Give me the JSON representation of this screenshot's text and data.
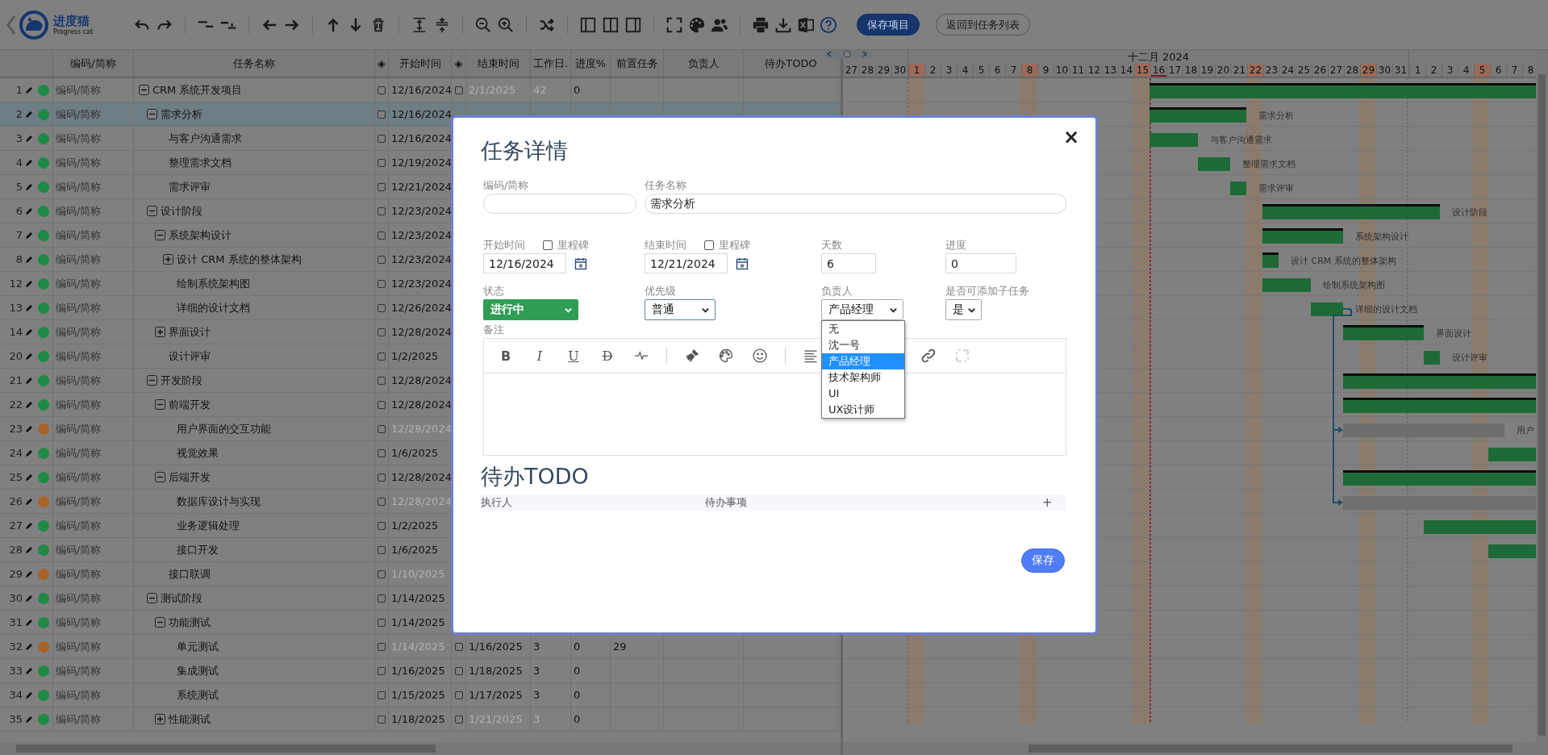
{
  "toolbar": {
    "logo": {
      "name": "进度猫",
      "subtitle": "Progress cat"
    },
    "buttons": [
      {
        "label": "保存项目",
        "kind": "primary"
      },
      {
        "label": "返回到任务列表",
        "kind": "secondary"
      }
    ]
  },
  "columns": [
    "编码/简称",
    "任务名称",
    "◈",
    "开始时间",
    "◈",
    "结束时间",
    "工作日.",
    "进度%",
    "前置任务",
    "负责人",
    "待办TODO"
  ],
  "tasks": [
    {
      "id": "1",
      "color": "#1f8a45",
      "code": "编码/简称",
      "name": "CRM 系统开发项目",
      "selected": false,
      "expanded": true,
      "start_milestone": false,
      "start": "12/16/2024",
      "start_muted": false,
      "end_milestone": false,
      "end": "2/1/2025",
      "end_muted": true,
      "workdays": "42",
      "progress": "0",
      "bar": {
        "kind": "summary"
      },
      "children": [
        {
          "id": "2",
          "color": "#1f8a45",
          "code": "编码/简称",
          "name": "需求分析",
          "selected": true,
          "expanded": true,
          "start_milestone": false,
          "start": "12/16/2024",
          "start_muted": false,
          "bar": {
            "kind": "summary",
            "label": "需求分析"
          },
          "children": [
            {
              "id": "3",
              "color": "#1f8a45",
              "code": "编码/简称",
              "name": "与客户沟通需求",
              "selected": false,
              "start_milestone": false,
              "start": "12/16/2024",
              "start_muted": false,
              "bar": {
                "kind": "task",
                "label": "与客户沟通需求"
              }
            },
            {
              "id": "4",
              "color": "#1f8a45",
              "code": "编码/简称",
              "name": "整理需求文档",
              "selected": false,
              "start_milestone": false,
              "start": "12/19/2024",
              "start_muted": false,
              "bar": {
                "kind": "task",
                "label": "整理需求文档"
              }
            },
            {
              "id": "5",
              "color": "#1f8a45",
              "code": "编码/简称",
              "name": "需求评审",
              "selected": false,
              "start_milestone": false,
              "start": "12/21/2024",
              "start_muted": false,
              "bar": {
                "kind": "task",
                "label": "需求评审"
              }
            }
          ]
        },
        {
          "id": "6",
          "color": "#1f8a45",
          "code": "编码/简称",
          "name": "设计阶段",
          "selected": false,
          "expanded": true,
          "start_milestone": false,
          "start": "12/23/2024",
          "start_muted": false,
          "bar": {
            "kind": "summary",
            "label": "设计阶段"
          },
          "children": [
            {
              "id": "7",
              "color": "#1f8a45",
              "code": "编码/简称",
              "name": "系统架构设计",
              "selected": false,
              "expanded": true,
              "start_milestone": false,
              "start": "12/23/2024",
              "start_muted": false,
              "bar": {
                "kind": "summary",
                "label": "系统架构设计"
              },
              "children": [
                {
                  "id": "8",
                  "color": "#1f8a45",
                  "code": "编码/简称",
                  "name": "设计 CRM 系统的整体架构",
                  "selected": false,
                  "expanded": false,
                  "start_milestone": false,
                  "start": "12/23/2024",
                  "start_muted": false,
                  "bar": {
                    "kind": "summary",
                    "label": "设计 CRM 系统的整体架构"
                  }
                },
                {
                  "id": "12",
                  "color": "#1f8a45",
                  "code": "编码/简称",
                  "name": "绘制系统架构图",
                  "selected": false,
                  "start_milestone": false,
                  "start": "12/23/2024",
                  "start_muted": false,
                  "bar": {
                    "kind": "task",
                    "label": "绘制系统架构图"
                  }
                },
                {
                  "id": "13",
                  "color": "#1f8a45",
                  "code": "编码/简称",
                  "name": "详细的设计文档",
                  "selected": false,
                  "start_milestone": false,
                  "start": "12/26/2024",
                  "start_muted": false,
                  "bar": {
                    "kind": "task",
                    "label": "详细的设计文档",
                    "link_source": true
                  }
                }
              ]
            },
            {
              "id": "14",
              "color": "#1f8a45",
              "code": "编码/简称",
              "name": "界面设计",
              "selected": false,
              "expanded": false,
              "start_milestone": false,
              "start": "12/28/2024",
              "start_muted": false,
              "bar": {
                "kind": "summary",
                "label": "界面设计"
              }
            },
            {
              "id": "20",
              "color": "#1f8a45",
              "code": "编码/简称",
              "name": "设计评审",
              "selected": false,
              "start_milestone": false,
              "start": "1/2/2025",
              "start_muted": false,
              "bar": {
                "kind": "task",
                "label": "设计评审"
              }
            }
          ]
        },
        {
          "id": "21",
          "color": "#1f8a45",
          "code": "编码/简称",
          "name": "开发阶段",
          "selected": false,
          "expanded": true,
          "start_milestone": false,
          "start": "12/28/2024",
          "start_muted": false,
          "bar": {
            "kind": "summary"
          },
          "children": [
            {
              "id": "22",
              "color": "#1f8a45",
              "code": "编码/简称",
              "name": "前端开发",
              "selected": false,
              "expanded": true,
              "start_milestone": false,
              "start": "12/28/2024",
              "start_muted": false,
              "bar": {
                "kind": "summary"
              },
              "children": [
                {
                  "id": "23",
                  "color": "#a8632a",
                  "code": "编码/简称",
                  "name": "用户界面的交互功能",
                  "selected": false,
                  "start_milestone": false,
                  "start": "12/28/2024",
                  "start_muted": true,
                  "bar": {
                    "kind": "pending",
                    "label": "用户",
                    "linked": true
                  }
                },
                {
                  "id": "24",
                  "color": "#1f8a45",
                  "code": "编码/简称",
                  "name": "视觉效果",
                  "selected": false,
                  "start_milestone": false,
                  "start": "1/6/2025",
                  "start_muted": false,
                  "bar": {
                    "kind": "task"
                  }
                }
              ]
            },
            {
              "id": "25",
              "color": "#1f8a45",
              "code": "编码/简称",
              "name": "后端开发",
              "selected": false,
              "expanded": true,
              "start_milestone": false,
              "start": "12/28/2024",
              "start_muted": false,
              "bar": {
                "kind": "summary"
              },
              "children": [
                {
                  "id": "26",
                  "color": "#a8632a",
                  "code": "编码/简称",
                  "name": "数据库设计与实现",
                  "selected": false,
                  "start_milestone": false,
                  "start": "12/28/2024",
                  "start_muted": true,
                  "bar": {
                    "kind": "pending",
                    "linked": true
                  }
                },
                {
                  "id": "27",
                  "color": "#1f8a45",
                  "code": "编码/简称",
                  "name": "业务逻辑处理",
                  "selected": false,
                  "start_milestone": false,
                  "start": "1/2/2025",
                  "start_muted": false,
                  "bar": {
                    "kind": "task"
                  }
                },
                {
                  "id": "28",
                  "color": "#1f8a45",
                  "code": "编码/简称",
                  "name": "接口开发",
                  "selected": false,
                  "start_milestone": false,
                  "start": "1/6/2025",
                  "start_muted": false,
                  "bar": {
                    "kind": "task"
                  }
                }
              ]
            },
            {
              "id": "29",
              "color": "#a8632a",
              "code": "编码/简称",
              "name": "接口联调",
              "selected": false,
              "start_milestone": false,
              "start": "1/10/2025",
              "start_muted": true
            }
          ]
        },
        {
          "id": "30",
          "color": "#1f8a45",
          "code": "编码/简称",
          "name": "测试阶段",
          "selected": false,
          "expanded": true,
          "start_milestone": false,
          "start": "1/14/2025",
          "start_muted": false,
          "children": [
            {
              "id": "31",
              "color": "#1f8a45",
              "code": "编码/简称",
              "name": "功能测试",
              "selected": false,
              "expanded": true,
              "start_milestone": false,
              "start": "1/14/2025",
              "start_muted": false,
              "children": [
                {
                  "id": "32",
                  "color": "#a8632a",
                  "code": "编码/简称",
                  "name": "单元测试",
                  "selected": false,
                  "start_milestone": false,
                  "start": "1/14/2025",
                  "start_muted": true,
                  "end_milestone": false,
                  "end": "1/16/2025",
                  "end_muted": false,
                  "workdays": "3",
                  "progress": "0",
                  "predecessor": "29"
                },
                {
                  "id": "33",
                  "color": "#1f8a45",
                  "code": "编码/简称",
                  "name": "集成测试",
                  "selected": false,
                  "start_milestone": false,
                  "start": "1/16/2025",
                  "start_muted": false,
                  "end_milestone": false,
                  "end": "1/18/2025",
                  "end_muted": false,
                  "workdays": "3",
                  "progress": "0"
                },
                {
                  "id": "34",
                  "color": "#1f8a45",
                  "code": "编码/简称",
                  "name": "系统测试",
                  "selected": false,
                  "start_milestone": false,
                  "start": "1/15/2025",
                  "start_muted": false,
                  "end_milestone": false,
                  "end": "1/17/2025",
                  "end_muted": false,
                  "workdays": "3",
                  "progress": "0"
                }
              ]
            },
            {
              "id": "35",
              "color": "#1f8a45",
              "code": "编码/简称",
              "name": "性能测试",
              "selected": false,
              "expanded": false,
              "start_milestone": false,
              "start": "1/18/2025",
              "start_muted": false,
              "end_milestone": false,
              "end": "1/21/2025",
              "end_muted": true,
              "workdays": "3",
              "progress": "0"
            }
          ]
        }
      ]
    }
  ],
  "gantt": {
    "months": [
      {
        "days": [
          {
            "label": "27",
            "weekend": false,
            "today": false
          },
          {
            "label": "28",
            "weekend": false,
            "today": false
          },
          {
            "label": "29",
            "weekend": false,
            "today": false
          },
          {
            "label": "30",
            "weekend": false,
            "today": false
          }
        ]
      },
      {
        "label": "十二月 2024",
        "days": [
          {
            "label": "1",
            "weekend": true,
            "today": false
          },
          {
            "label": "2",
            "weekend": false,
            "today": false
          },
          {
            "label": "3",
            "weekend": false,
            "today": false
          },
          {
            "label": "4",
            "weekend": false,
            "today": false
          },
          {
            "label": "5",
            "weekend": false,
            "today": false
          },
          {
            "label": "6",
            "weekend": false,
            "today": false
          },
          {
            "label": "7",
            "weekend": false,
            "today": false
          },
          {
            "label": "8",
            "weekend": true,
            "today": false
          },
          {
            "label": "9",
            "weekend": false,
            "today": false
          },
          {
            "label": "10",
            "weekend": false,
            "today": false
          },
          {
            "label": "11",
            "weekend": false,
            "today": false
          },
          {
            "label": "12",
            "weekend": false,
            "today": false
          },
          {
            "label": "13",
            "weekend": false,
            "today": false
          },
          {
            "label": "14",
            "weekend": false,
            "today": false
          },
          {
            "label": "15",
            "weekend": true,
            "today": false
          },
          {
            "label": "16",
            "weekend": false,
            "today": true
          },
          {
            "label": "17",
            "weekend": false,
            "today": false
          },
          {
            "label": "18",
            "weekend": false,
            "today": false
          },
          {
            "label": "19",
            "weekend": false,
            "today": false
          },
          {
            "label": "20",
            "weekend": false,
            "today": false
          },
          {
            "label": "21",
            "weekend": false,
            "today": false
          },
          {
            "label": "22",
            "weekend": true,
            "today": false
          },
          {
            "label": "23",
            "weekend": false,
            "today": false
          },
          {
            "label": "24",
            "weekend": false,
            "today": false
          },
          {
            "label": "25",
            "weekend": false,
            "today": false
          },
          {
            "label": "26",
            "weekend": false,
            "today": false
          },
          {
            "label": "27",
            "weekend": false,
            "today": false
          },
          {
            "label": "28",
            "weekend": false,
            "today": false
          },
          {
            "label": "29",
            "weekend": true,
            "today": false
          },
          {
            "label": "30",
            "weekend": false,
            "today": false
          },
          {
            "label": "31",
            "weekend": false,
            "today": false
          }
        ]
      },
      {
        "days": [
          {
            "label": "1",
            "weekend": false,
            "today": false
          },
          {
            "label": "2",
            "weekend": false,
            "today": false
          },
          {
            "label": "3",
            "weekend": false,
            "today": false
          },
          {
            "label": "4",
            "weekend": false,
            "today": false
          },
          {
            "label": "5",
            "weekend": true,
            "today": false
          },
          {
            "label": "6",
            "weekend": false,
            "today": false
          },
          {
            "label": "7",
            "weekend": false,
            "today": false
          },
          {
            "label": "8",
            "weekend": false,
            "today": false
          }
        ]
      }
    ]
  },
  "dialog": {
    "title": "任务详情",
    "close": "×",
    "code": {
      "label": "编码/简称"
    },
    "name": {
      "label": "任务名称",
      "value": "需求分析"
    },
    "start": {
      "label": "开始时间",
      "milestone_label": "里程碑",
      "milestone": false,
      "value": "12/16/2024"
    },
    "end": {
      "label": "结束时间",
      "milestone_label": "里程碑",
      "milestone": false,
      "value": "12/21/2024"
    },
    "days": {
      "label": "天数",
      "value": "6"
    },
    "progress": {
      "label": "进度",
      "value": "0"
    },
    "status": {
      "label": "状态",
      "value": "进行中"
    },
    "priority": {
      "label": "优先级",
      "value": "普通"
    },
    "owner": {
      "label": "负责人",
      "value": "产品经理",
      "expanded": true,
      "options": [
        {
          "label": "无",
          "selected": false
        },
        {
          "label": "沈一号",
          "selected": false
        },
        {
          "label": "产品经理",
          "selected": true
        },
        {
          "label": "技术架构师",
          "selected": false
        },
        {
          "label": "UI",
          "selected": false
        },
        {
          "label": "UX设计师",
          "selected": false
        }
      ]
    },
    "subtasks": {
      "label": "是否可添加子任务",
      "value": "是"
    },
    "notes": {
      "label": "备注",
      "tools": [
        {
          "kind": "bold",
          "label": "B"
        },
        {
          "kind": "italic",
          "label": "I"
        },
        {
          "kind": "underline",
          "label": "U"
        },
        {
          "kind": "strike",
          "label": "D"
        },
        {
          "kind": "pulse"
        },
        {
          "kind": "separator"
        },
        {
          "kind": "brush"
        },
        {
          "kind": "palette"
        },
        {
          "kind": "smile"
        },
        {
          "kind": "separator"
        },
        {
          "kind": "align"
        },
        {
          "kind": "link"
        },
        {
          "kind": "unlink"
        }
      ]
    },
    "todo": {
      "title": "待办TODO",
      "columns": [
        "执行人",
        "待办事项"
      ],
      "add": "+"
    },
    "save": "保存"
  }
}
